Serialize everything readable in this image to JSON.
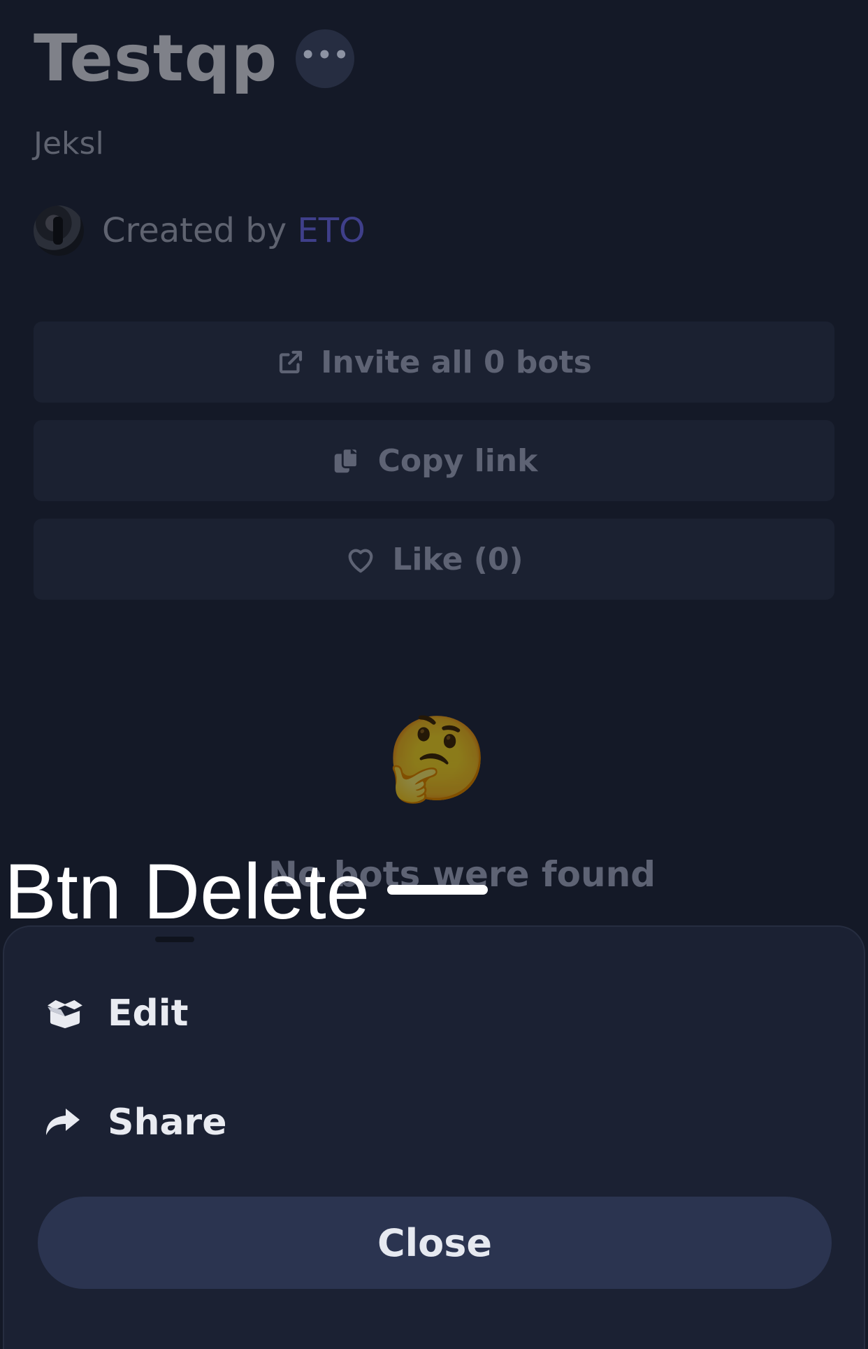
{
  "page": {
    "title": "Testqp",
    "more_label": "•••",
    "subtitle": "Jeksl",
    "created_by_prefix": "Created by ",
    "creator_name": "ETO"
  },
  "actions": {
    "invite_label": "Invite all 0 bots",
    "copy_label": "Copy link",
    "like_label": "Like (0)"
  },
  "empty_state": {
    "emoji": "🤔",
    "message": "No bots were found"
  },
  "overlay": {
    "label": "Btn Delete"
  },
  "sheet": {
    "edit_label": "Edit",
    "share_label": "Share",
    "close_label": "Close"
  },
  "icons": {
    "invite": "external-link-icon",
    "copy": "copy-icon",
    "like": "heart-icon",
    "edit": "box-open-icon",
    "share": "share-arrow-icon"
  },
  "colors": {
    "background": "#141927",
    "sheet": "#1b2133",
    "close_button": "#2b3450",
    "creator_link": "#3f3f8a"
  }
}
